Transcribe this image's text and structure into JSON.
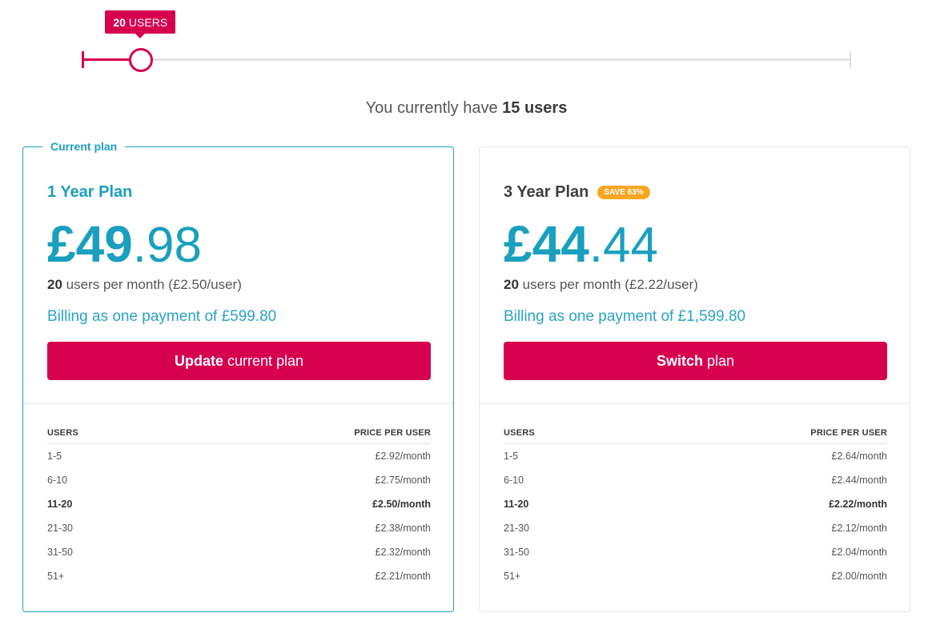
{
  "slider": {
    "selected_users": "20",
    "unit_label": "USERS",
    "min_users": 1,
    "max_users": 250,
    "value": 20,
    "accent_color": "#d6004f"
  },
  "current_users": {
    "prefix": "You currently have",
    "count": "15 users"
  },
  "plans": [
    {
      "current_label": "Current plan",
      "name": "1 Year Plan",
      "badge": "",
      "price_whole": "£49",
      "price_dot": ".",
      "price_cents": "98",
      "users_count": "20",
      "users_text": "users per month (£2.50/user)",
      "billing": "Billing as one payment of £599.80",
      "button_bold": "Update",
      "button_rest": "current plan",
      "tiers_header": {
        "users": "USERS",
        "price": "PRICE PER USER"
      },
      "tiers": [
        {
          "range": "1-5",
          "price": "£2.92/month"
        },
        {
          "range": "6-10",
          "price": "£2.75/month"
        },
        {
          "range": "11-20",
          "price": "£2.50/month"
        },
        {
          "range": "21-30",
          "price": "£2.38/month"
        },
        {
          "range": "31-50",
          "price": "£2.32/month"
        },
        {
          "range": "51+",
          "price": "£2.21/month"
        }
      ]
    },
    {
      "current_label": "",
      "name": "3 Year Plan",
      "badge": "SAVE 63%",
      "price_whole": "£44",
      "price_dot": ".",
      "price_cents": "44",
      "users_count": "20",
      "users_text": "users per month (£2.22/user)",
      "billing": "Billing as one payment of £1,599.80",
      "button_bold": "Switch",
      "button_rest": "plan",
      "tiers_header": {
        "users": "USERS",
        "price": "PRICE PER USER"
      },
      "tiers": [
        {
          "range": "1-5",
          "price": "£2.64/month"
        },
        {
          "range": "6-10",
          "price": "£2.44/month"
        },
        {
          "range": "11-20",
          "price": "£2.22/month"
        },
        {
          "range": "21-30",
          "price": "£2.12/month"
        },
        {
          "range": "31-50",
          "price": "£2.04/month"
        },
        {
          "range": "51+",
          "price": "£2.00/month"
        }
      ]
    }
  ],
  "colors": {
    "primary": "#d6004f",
    "accent": "#1a9fbf",
    "badge": "#f6a623"
  }
}
